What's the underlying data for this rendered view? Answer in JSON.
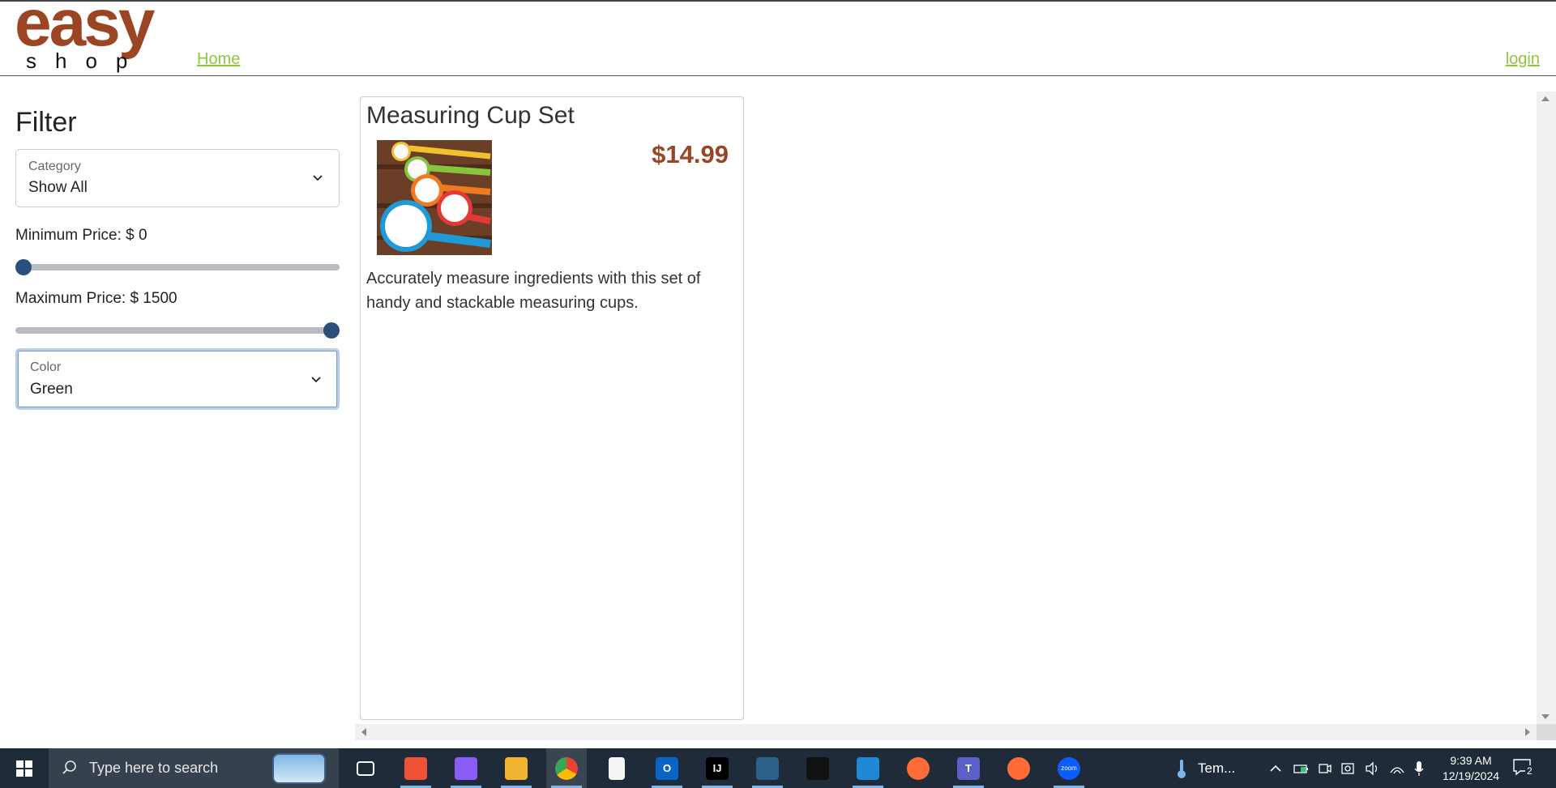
{
  "header": {
    "logo_main": "easy",
    "logo_sub": "shop",
    "nav_home": "Home",
    "nav_login": "login",
    "brand_color": "#9c4524",
    "link_color": "#8dc63f"
  },
  "filter": {
    "title": "Filter",
    "category": {
      "label": "Category",
      "value": "Show All"
    },
    "min_price": {
      "label": "Minimum Price: $ 0",
      "value": 0,
      "fraction": 0.0
    },
    "max_price": {
      "label": "Maximum Price: $ 1500",
      "value": 1500,
      "fraction": 1.0
    },
    "color": {
      "label": "Color",
      "value": "Green"
    }
  },
  "product": {
    "name": "Measuring Cup Set",
    "price": "$14.99",
    "description": "Accurately measure ingredients with this set of handy and stackable measuring cups.",
    "image_icon": "measuring-cups-image"
  },
  "taskbar": {
    "search_placeholder": "Type here to search",
    "weather_text": "Tem...",
    "time": "9:39 AM",
    "date": "12/19/2024",
    "notification_count": "2",
    "apps": [
      {
        "name": "task-view",
        "glyph": "",
        "color": "#1f2b38"
      },
      {
        "name": "git",
        "glyph": "",
        "color": "#f05033"
      },
      {
        "name": "copilot",
        "glyph": "",
        "color": "#8a5cf6"
      },
      {
        "name": "file-explorer",
        "glyph": "",
        "color": "#f2b531"
      },
      {
        "name": "chrome",
        "glyph": "",
        "color": "#4285f4"
      },
      {
        "name": "notepad",
        "glyph": "",
        "color": "#f5f5f5"
      },
      {
        "name": "outlook",
        "glyph": "O",
        "color": "#0a64c8"
      },
      {
        "name": "intellij",
        "glyph": "IJ",
        "color": "#000000"
      },
      {
        "name": "mysql-workbench",
        "glyph": "",
        "color": "#2c5f8a"
      },
      {
        "name": "terminal-app",
        "glyph": "",
        "color": "#111111"
      },
      {
        "name": "vscode",
        "glyph": "",
        "color": "#1e8ad6"
      },
      {
        "name": "postman",
        "glyph": "",
        "color": "#ff6c37"
      },
      {
        "name": "teams",
        "glyph": "T",
        "color": "#5b5fc7"
      },
      {
        "name": "compass",
        "glyph": "",
        "color": "#ff6c37"
      },
      {
        "name": "zoom",
        "glyph": "zoom",
        "color": "#0b5cff"
      }
    ]
  }
}
